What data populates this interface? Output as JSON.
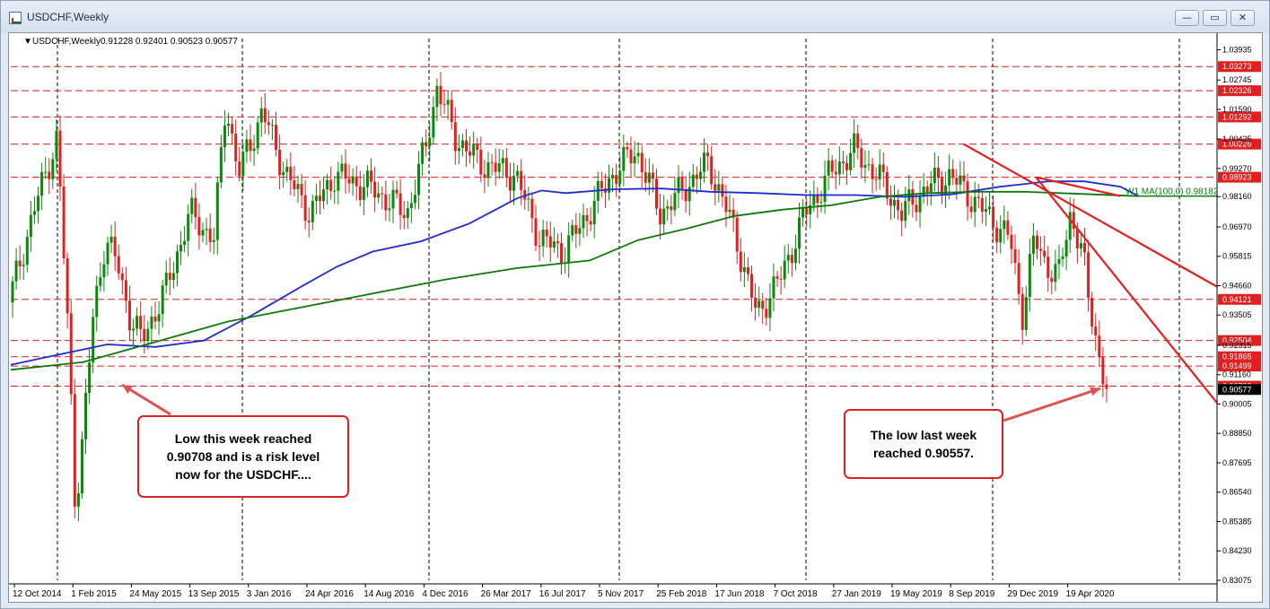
{
  "window": {
    "title": "USDCHF,Weekly",
    "buttons": [
      "—",
      "▭",
      "✕"
    ]
  },
  "chart_info": {
    "symbol_text": "USDCHF,Weekly",
    "ohlc_text": "0.91228 0.92401 0.90523 0.90577"
  },
  "chart_data": {
    "type": "candlestick",
    "symbol": "USDCHF",
    "timeframe": "Weekly",
    "ohlc": {
      "open": 0.91228,
      "high": 0.92401,
      "low": 0.90523,
      "close": 0.90577
    },
    "ylim": [
      0.83075,
      1.04375
    ],
    "y_ticks": [
      1.03935,
      1.02745,
      1.0159,
      1.00425,
      0.9927,
      0.9816,
      0.9697,
      0.95815,
      0.9466,
      0.93505,
      0.92315,
      0.9116,
      0.90005,
      0.8885,
      0.87695,
      0.8654,
      0.85385,
      0.8423,
      0.83075
    ],
    "x_labels": [
      "12 Oct 2014",
      "1 Feb 2015",
      "24 May 2015",
      "13 Sep 2015",
      "3 Jan 2016",
      "24 Apr 2016",
      "14 Aug 2016",
      "4 Dec 2016",
      "26 Mar 2017",
      "16 Jul 2017",
      "5 Nov 2017",
      "25 Feb 2018",
      "17 Jun 2018",
      "7 Oct 2018",
      "27 Jan 2019",
      "19 May 2019",
      "8 Sep 2019",
      "29 Dec 2019",
      "19 Apr 2020"
    ],
    "levels": [
      1.03273,
      1.02326,
      1.01292,
      1.00226,
      0.98923,
      0.94121,
      0.92504,
      0.91865,
      0.91499,
      0.90708
    ],
    "current_price": 0.90577,
    "moving_average": {
      "label": "W1 MA(100,0) 0.98182",
      "value": 0.98182
    },
    "series": [
      {
        "name": "",
        "color": "#1f2ccf",
        "points": [
          [
            0,
            0.9155
          ],
          [
            0.04,
            0.9195
          ],
          [
            0.08,
            0.9235
          ],
          [
            0.12,
            0.9225
          ],
          [
            0.16,
            0.925
          ],
          [
            0.2,
            0.935
          ],
          [
            0.24,
            0.946
          ],
          [
            0.27,
            0.954
          ],
          [
            0.3,
            0.96
          ],
          [
            0.34,
            0.964
          ],
          [
            0.38,
            0.971
          ],
          [
            0.42,
            0.981
          ],
          [
            0.44,
            0.984
          ],
          [
            0.46,
            0.983
          ],
          [
            0.5,
            0.9845
          ],
          [
            0.54,
            0.9848
          ],
          [
            0.58,
            0.9835
          ],
          [
            0.62,
            0.983
          ],
          [
            0.66,
            0.9822
          ],
          [
            0.7,
            0.9822
          ],
          [
            0.74,
            0.9815
          ],
          [
            0.78,
            0.9825
          ],
          [
            0.82,
            0.9855
          ],
          [
            0.86,
            0.9876
          ],
          [
            0.89,
            0.9876
          ],
          [
            0.92,
            0.9855
          ],
          [
            0.935,
            0.9818
          ]
        ]
      },
      {
        "name": "",
        "color": "#0a7a0a",
        "points": [
          [
            0,
            0.9135
          ],
          [
            0.06,
            0.9165
          ],
          [
            0.12,
            0.9245
          ],
          [
            0.18,
            0.9325
          ],
          [
            0.24,
            0.938
          ],
          [
            0.3,
            0.9435
          ],
          [
            0.36,
            0.949
          ],
          [
            0.42,
            0.9535
          ],
          [
            0.48,
            0.9565
          ],
          [
            0.52,
            0.9645
          ],
          [
            0.56,
            0.969
          ],
          [
            0.6,
            0.974
          ],
          [
            0.64,
            0.9765
          ],
          [
            0.68,
            0.9782
          ],
          [
            0.72,
            0.9815
          ],
          [
            0.76,
            0.983
          ],
          [
            0.8,
            0.9835
          ],
          [
            0.84,
            0.9835
          ],
          [
            0.88,
            0.9828
          ],
          [
            0.935,
            0.9818
          ]
        ]
      }
    ],
    "trendlines": [
      {
        "from": [
          0.79,
          1.00226
        ],
        "to": [
          1.0,
          0.9462
        ]
      },
      {
        "from": [
          0.85,
          0.98923
        ],
        "to": [
          1.0,
          0.9005
        ]
      }
    ],
    "annotations": [
      {
        "text": [
          "Low this week reached",
          "0.90708 and is a risk level",
          "now for the USDCHF...."
        ]
      },
      {
        "text": [
          "The low last week",
          "reached 0.90557."
        ]
      }
    ],
    "grid": true
  }
}
